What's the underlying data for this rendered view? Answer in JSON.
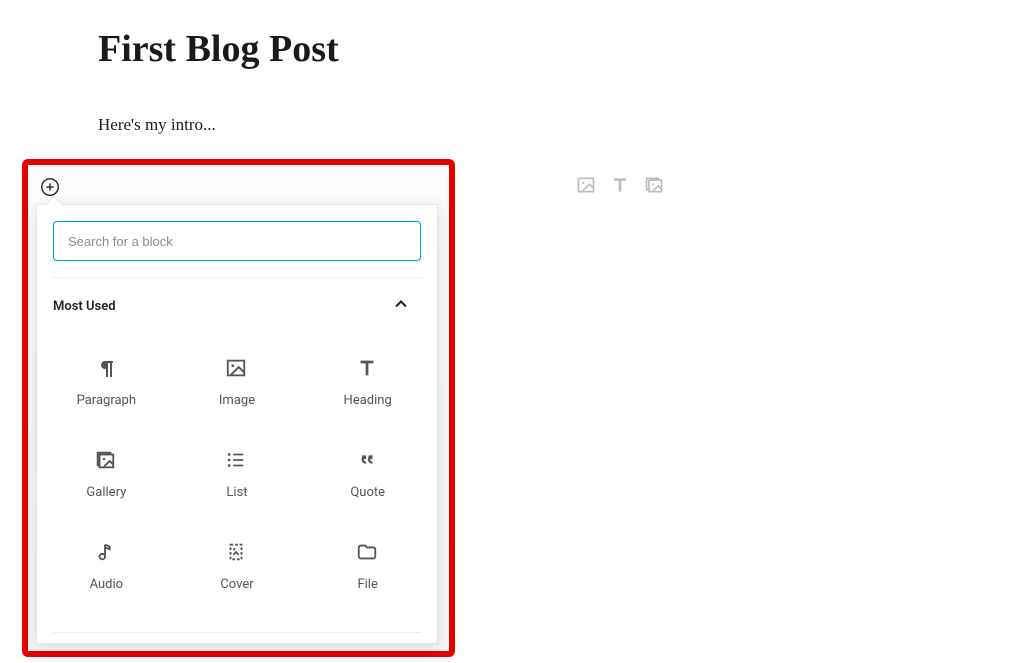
{
  "post": {
    "title": "First Blog Post",
    "intro": "Here's my intro..."
  },
  "inserter": {
    "search_placeholder": "Search for a block",
    "section_label": "Most Used",
    "blocks": {
      "paragraph": "Paragraph",
      "image": "Image",
      "heading": "Heading",
      "gallery": "Gallery",
      "list": "List",
      "quote": "Quote",
      "audio": "Audio",
      "cover": "Cover",
      "file": "File"
    }
  }
}
